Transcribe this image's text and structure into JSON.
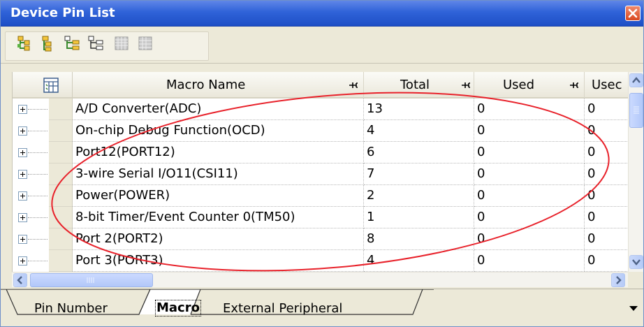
{
  "window": {
    "title": "Device Pin List"
  },
  "toolbar": {
    "icons": [
      "expand-all-icon",
      "collapse-all-icon",
      "expand-node-icon",
      "collapse-node-icon",
      "show-used-icon",
      "show-unused-icon"
    ]
  },
  "table": {
    "columns": {
      "name": "Macro Name",
      "total": "Total",
      "used": "Used",
      "used2": "Usec"
    },
    "rows": [
      {
        "name": "A/D Converter(ADC)",
        "total": "13",
        "used": "0",
        "used2": "0"
      },
      {
        "name": "On-chip Debug Function(OCD)",
        "total": "4",
        "used": "0",
        "used2": "0"
      },
      {
        "name": "Port12(PORT12)",
        "total": "6",
        "used": "0",
        "used2": "0"
      },
      {
        "name": "3-wire Serial I/O11(CSI11)",
        "total": "7",
        "used": "0",
        "used2": "0"
      },
      {
        "name": "Power(POWER)",
        "total": "2",
        "used": "0",
        "used2": "0"
      },
      {
        "name": "8-bit Timer/Event Counter 0(TM50)",
        "total": "1",
        "used": "0",
        "used2": "0"
      },
      {
        "name": "Port 2(PORT2)",
        "total": "8",
        "used": "0",
        "used2": "0"
      },
      {
        "name": "Port 3(PORT3)",
        "total": "4",
        "used": "0",
        "used2": "0"
      }
    ]
  },
  "tabs": [
    {
      "label": "Pin Number",
      "active": false
    },
    {
      "label": "Macro",
      "active": true
    },
    {
      "label": "External Peripheral",
      "active": false
    }
  ],
  "colors": {
    "titlebar": "#2f62d8",
    "annotation": "#e8212a",
    "chrome": "#ece9d8"
  }
}
